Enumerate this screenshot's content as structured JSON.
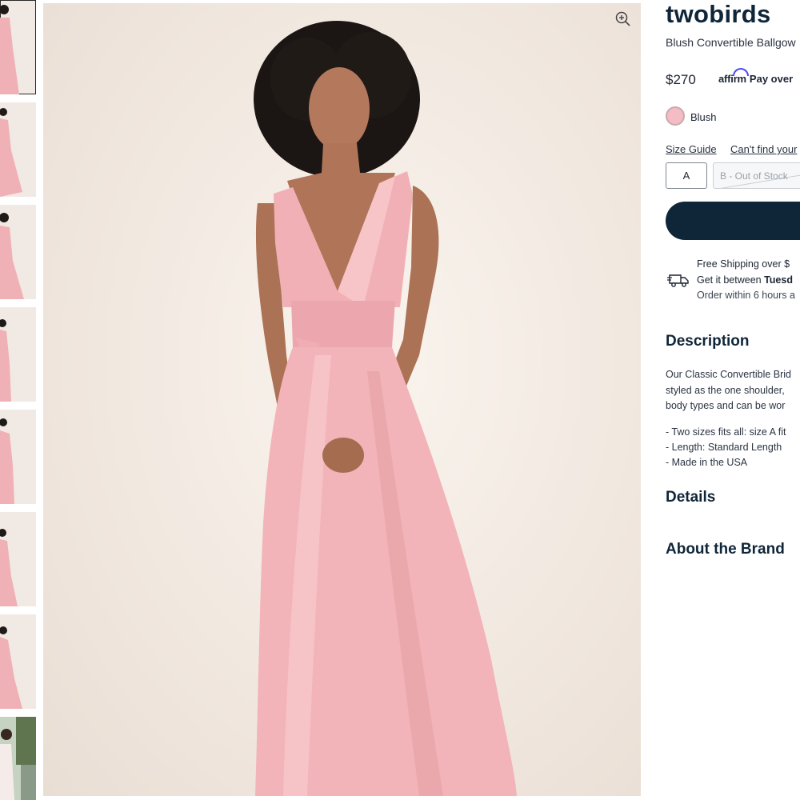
{
  "product": {
    "brand": "twobirds",
    "name": "Blush Convertible Ballgow",
    "price": "$270",
    "affirm": {
      "logo": "affirm",
      "text": "Pay over"
    },
    "color": {
      "label": "Blush",
      "swatch": "#f4bcc4"
    },
    "size_guide": "Size Guide",
    "cant_find": "Can't find your",
    "sizes": [
      {
        "label": "A",
        "available": true
      },
      {
        "label": "B - Out of Stock",
        "available": false
      }
    ],
    "add_to_bag_color": "#0f2538"
  },
  "shipping": {
    "line1": "Free Shipping over $",
    "line2_prefix": "Get it between ",
    "line2_bold": "Tuesd",
    "line3": "Order within 6 hours a"
  },
  "description": {
    "heading": "Description",
    "lines": [
      "Our Classic Convertible Brid",
      "styled as the one shoulder,",
      "body types and can be wor"
    ],
    "bullets": [
      "- Two sizes fits all: size A fit",
      "- Length: Standard Length",
      "- Made in the USA"
    ]
  },
  "details_heading": "Details",
  "about_heading": "About the Brand",
  "icons": [
    "zoom-in-icon",
    "delivery-truck-icon"
  ],
  "colors": {
    "navy": "#0f2538",
    "dress": "#f2b4b8",
    "backdrop": "#f3ebe3"
  }
}
